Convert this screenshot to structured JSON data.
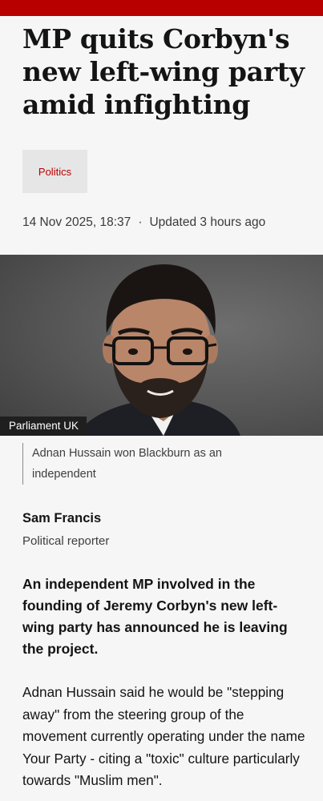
{
  "article": {
    "headline": "MP quits Corbyn's new left-wing party amid infighting",
    "topic": "Politics",
    "date": "14 Nov 2025, 18:37",
    "separator": "·",
    "updated": "Updated 3 hours ago",
    "image": {
      "credit": "Parliament UK",
      "caption": "Adnan Hussain won Blackburn as an independent"
    },
    "author": {
      "name": "Sam Francis",
      "role": "Political reporter"
    },
    "lead": "An independent MP involved in the founding of Jeremy Corbyn's new left-wing party has announced he is leaving the project.",
    "paragraph_1": "Adnan Hussain said he would be \"stepping away\" from the steering group of the movement currently operating under the name Your Party - citing a \"toxic\" culture particularly towards \"Muslim men\"."
  },
  "colors": {
    "brand_red": "#b80000",
    "background": "#f6f6f6",
    "tag_background": "#e6e6e6"
  }
}
